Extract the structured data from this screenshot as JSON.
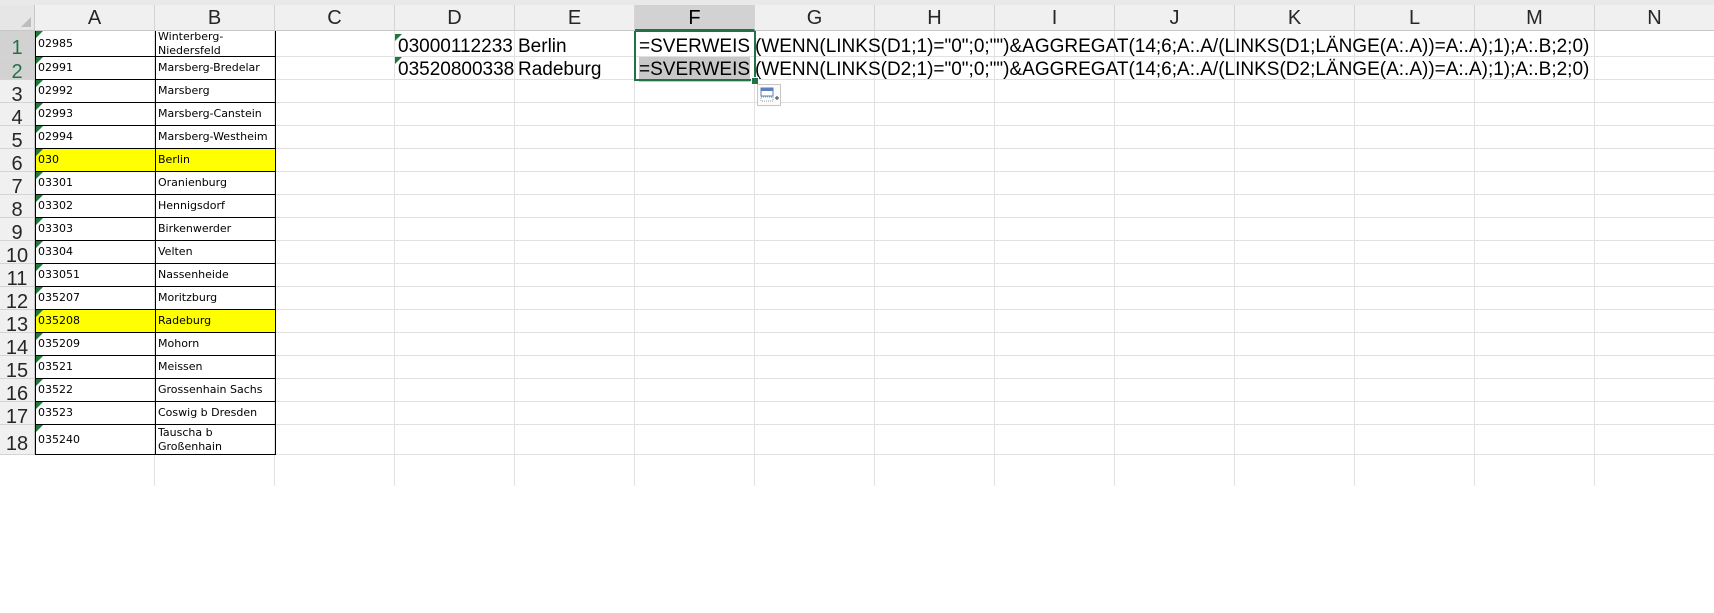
{
  "columns": [
    "A",
    "B",
    "C",
    "D",
    "E",
    "F",
    "G",
    "H",
    "I",
    "J",
    "K",
    "L",
    "M",
    "N"
  ],
  "rows": [
    "1",
    "2",
    "3",
    "4",
    "5",
    "6",
    "7",
    "8",
    "9",
    "10",
    "11",
    "12",
    "13",
    "14",
    "15",
    "16",
    "17",
    "18"
  ],
  "selected_column": "F",
  "selected_rows": [
    "1",
    "2"
  ],
  "column_a": [
    "02985",
    "02991",
    "02992",
    "02993",
    "02994",
    "030",
    "03301",
    "03302",
    "03303",
    "03304",
    "033051",
    "035207",
    "035208",
    "035209",
    "03521",
    "03522",
    "03523",
    "035240"
  ],
  "column_b": [
    "Winterberg-Niedersfeld",
    "Marsberg-Bredelar",
    "Marsberg",
    "Marsberg-Canstein",
    "Marsberg-Westheim",
    "Berlin",
    "Oranienburg",
    "Hennigsdorf",
    "Birkenwerder",
    "Velten",
    "Nassenheide",
    "Moritzburg",
    "Radeburg",
    "Mohorn",
    "Meissen",
    "Grossenhain Sachs",
    "Coswig b Dresden",
    "Tauscha b Großenhain"
  ],
  "highlighted_rows": [
    6,
    13
  ],
  "highlight_color": "#ffff00",
  "accent_color": "#217346",
  "d_values": [
    "03000112233",
    "03520800338"
  ],
  "e_values": [
    "Berlin",
    "Radeburg"
  ],
  "f_formula_start": [
    "=SVERWEIS",
    "=SVERWEIS"
  ],
  "f_formula_rest": [
    "(WENN(LINKS(D1;1)=\"0\";0;\"\")&AGGREGAT(14;6;A:.A/(LINKS(D1;LÄNGE(A:.A))=A:.A);1);A:.B;2;0)",
    "(WENN(LINKS(D2;1)=\"0\";0;\"\")&AGGREGAT(14;6;A:.A/(LINKS(D2;LÄNGE(A:.A))=A:.A);1);A:.B;2;0)"
  ],
  "autofill_icon": "paste-options-icon"
}
